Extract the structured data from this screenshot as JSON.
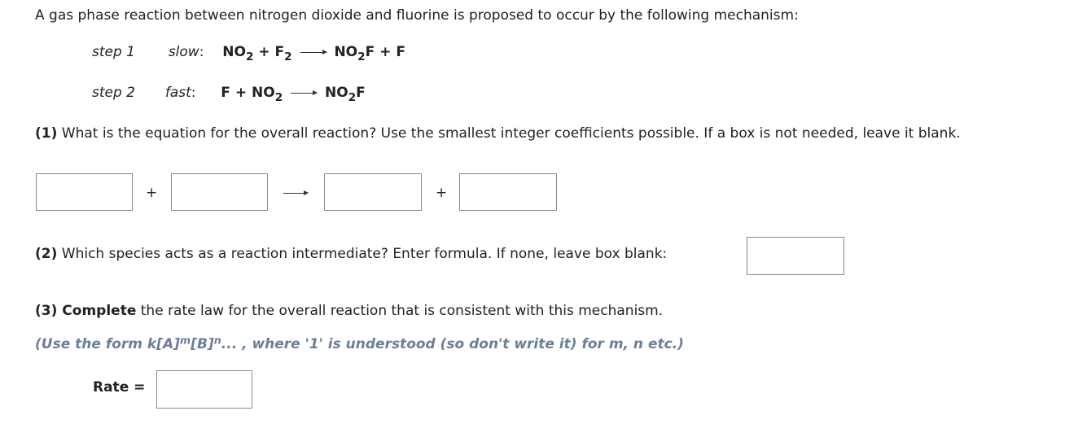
{
  "intro": "A gas phase reaction between nitrogen dioxide and fluorine is proposed to occur by the following mechanism:",
  "mechanism": [
    {
      "step": "step 1",
      "speed": "slow",
      "reactants": [
        {
          "base": "NO",
          "sub": "2"
        },
        {
          "base": "F",
          "sub": "2"
        }
      ],
      "products": [
        {
          "base": "NO",
          "sub": "2",
          "tail": "F"
        },
        {
          "base": "F",
          "sub": "",
          "tail": ""
        }
      ]
    },
    {
      "step": "step 2",
      "speed": "fast",
      "reactants": [
        {
          "base": "F",
          "sub": ""
        },
        {
          "base": "NO",
          "sub": "2"
        }
      ],
      "products": [
        {
          "base": "NO",
          "sub": "2",
          "tail": "F"
        }
      ]
    }
  ],
  "q1": {
    "number": "(1)",
    "text": " What is the equation for the overall reaction? Use the smallest integer coefficients possible. If a box is not needed, leave it blank.",
    "plus": "+",
    "inputs": [
      "",
      "",
      "",
      ""
    ]
  },
  "q2": {
    "number": "(2)",
    "text": " Which species acts as a reaction intermediate? Enter formula. If none, leave box blank:",
    "input": ""
  },
  "q3": {
    "number": "(3)",
    "bold_word": " Complete",
    "text": " the rate law for the overall reaction that is consistent with this mechanism.",
    "hint_pre": "(Use the form k[A]",
    "hint_m": "m",
    "hint_mid": "[B]",
    "hint_n": "n",
    "hint_post": "... , where '1' is understood (so don't write it) for m, n etc.)",
    "rate_label": "Rate =",
    "input": ""
  }
}
